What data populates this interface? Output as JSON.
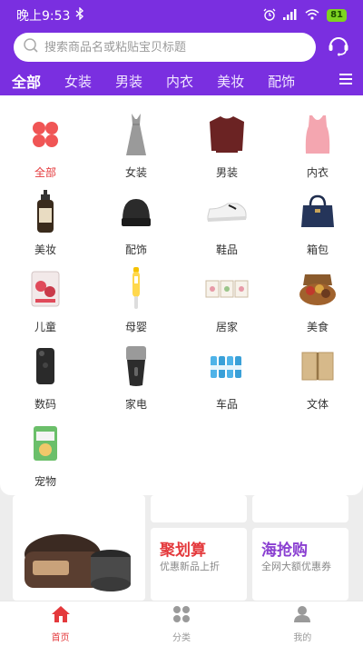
{
  "status": {
    "time": "晚上9:53",
    "battery": "81"
  },
  "search": {
    "placeholder": "搜索商品名或粘贴宝贝标题"
  },
  "tabs": [
    {
      "label": "全部",
      "active": true
    },
    {
      "label": "女装"
    },
    {
      "label": "男装"
    },
    {
      "label": "内衣"
    },
    {
      "label": "美妆"
    },
    {
      "label": "配饰"
    }
  ],
  "categories": [
    {
      "label": "全部",
      "icon": "clover-icon"
    },
    {
      "label": "女装",
      "icon": "dress-icon"
    },
    {
      "label": "男装",
      "icon": "sweater-icon"
    },
    {
      "label": "内衣",
      "icon": "tank-top-icon"
    },
    {
      "label": "美妆",
      "icon": "lotion-bottle-icon"
    },
    {
      "label": "配饰",
      "icon": "beanie-icon"
    },
    {
      "label": "鞋品",
      "icon": "sneaker-icon"
    },
    {
      "label": "箱包",
      "icon": "handbag-icon"
    },
    {
      "label": "儿童",
      "icon": "kids-package-icon"
    },
    {
      "label": "母婴",
      "icon": "thermometer-icon"
    },
    {
      "label": "居家",
      "icon": "picture-frames-icon"
    },
    {
      "label": "美食",
      "icon": "snack-basket-icon"
    },
    {
      "label": "数码",
      "icon": "phone-case-icon"
    },
    {
      "label": "家电",
      "icon": "shaver-icon"
    },
    {
      "label": "车品",
      "icon": "water-bottles-icon"
    },
    {
      "label": "文体",
      "icon": "notebook-icon"
    },
    {
      "label": "宠物",
      "icon": "pet-food-icon"
    }
  ],
  "promos": [
    {
      "title": "聚划算",
      "subtitle": "优惠新品上折",
      "color": "#e4393c"
    },
    {
      "title": "海抢购",
      "subtitle": "全网大额优惠券",
      "color": "#8a3fd1"
    }
  ],
  "bottom_nav": [
    {
      "label": "首页",
      "active": true
    },
    {
      "label": "分类"
    },
    {
      "label": "我的"
    }
  ],
  "colors": {
    "brand": "#7a2fe0",
    "accent": "#e4393c"
  }
}
